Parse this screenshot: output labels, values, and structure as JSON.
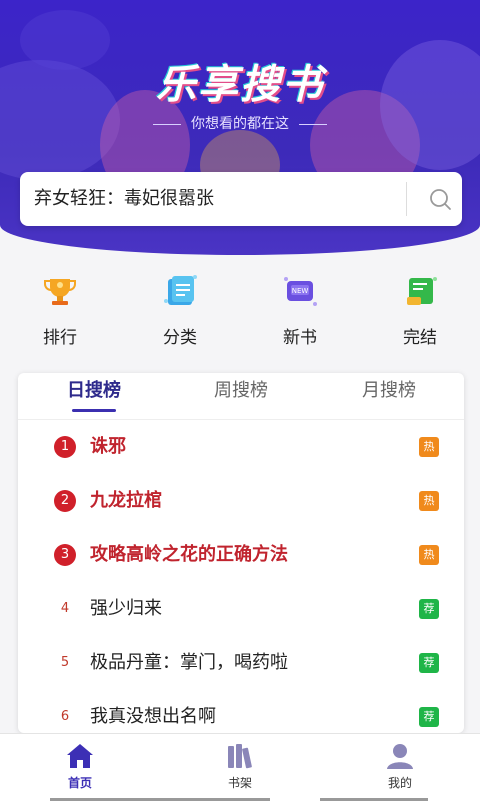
{
  "header": {
    "logo": "乐享搜书",
    "slogan": "你想看的都在这",
    "colors": {
      "primary": "#3c24c9",
      "accent_pink": "#e24d8a",
      "accent_cyan": "#27c9d6"
    }
  },
  "search": {
    "value": "弃女轻狂：毒妃很嚣张",
    "icon": "search-icon"
  },
  "categories": [
    {
      "label": "排行",
      "icon": "trophy-icon"
    },
    {
      "label": "分类",
      "icon": "category-icon"
    },
    {
      "label": "新书",
      "icon": "new-book-icon"
    },
    {
      "label": "完结",
      "icon": "finished-icon"
    }
  ],
  "ranking": {
    "tabs": [
      "日搜榜",
      "周搜榜",
      "月搜榜"
    ],
    "active_tab": "日搜榜",
    "items": [
      {
        "rank": "1",
        "title": "诛邪",
        "badge": "热",
        "type": "hot"
      },
      {
        "rank": "2",
        "title": "九龙拉棺",
        "badge": "热",
        "type": "hot"
      },
      {
        "rank": "3",
        "title": "攻略高岭之花的正确方法",
        "badge": "热",
        "type": "hot"
      },
      {
        "rank": "4",
        "title": "强少归来",
        "badge": "荐",
        "type": "rec"
      },
      {
        "rank": "5",
        "title": "极品丹童：掌门，喝药啦",
        "badge": "荐",
        "type": "rec"
      },
      {
        "rank": "6",
        "title": "我真没想出名啊",
        "badge": "荐",
        "type": "rec"
      }
    ]
  },
  "nav": [
    {
      "label": "首页",
      "icon": "home-icon",
      "active": true
    },
    {
      "label": "书架",
      "icon": "bookshelf-icon",
      "active": false
    },
    {
      "label": "我的",
      "icon": "profile-icon",
      "active": false
    }
  ]
}
